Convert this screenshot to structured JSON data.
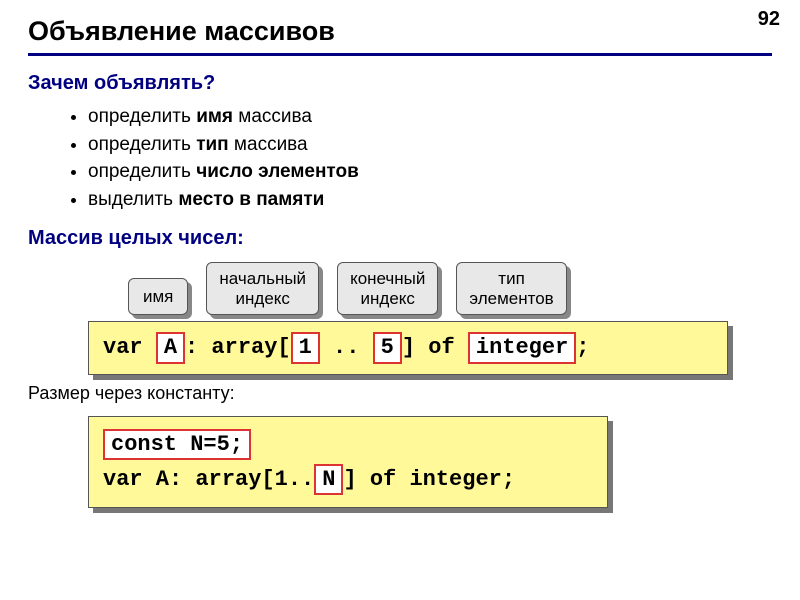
{
  "page_number": "92",
  "title": "Объявление массивов",
  "question": "Зачем объявлять?",
  "bullets": [
    {
      "pre": "определить ",
      "bold": "имя",
      "post": " массива"
    },
    {
      "pre": "определить ",
      "bold": "тип",
      "post": " массива"
    },
    {
      "pre": "определить ",
      "bold": "число элементов",
      "post": ""
    },
    {
      "pre": "выделить ",
      "bold": "место в памяти",
      "post": ""
    }
  ],
  "subhead1": "Массив целых чисел:",
  "labels": {
    "name": "имя",
    "start_index": {
      "l1": "начальный",
      "l2": "индекс"
    },
    "end_index": {
      "l1": "конечный",
      "l2": "индекс"
    },
    "elem_type": {
      "l1": "тип",
      "l2": "элементов"
    }
  },
  "code1": {
    "var": "var ",
    "arr_name": "A",
    "mid1": ": array[",
    "idx_start": "1",
    "dots": " .. ",
    "idx_end": "5",
    "mid2": "] of ",
    "type": "integer",
    "end": ";"
  },
  "inter": "Размер через константу:",
  "code2": {
    "const_line": "const N=5;",
    "var_pre": "var A: array[1..",
    "n": "N",
    "var_post": "] of integer;"
  }
}
